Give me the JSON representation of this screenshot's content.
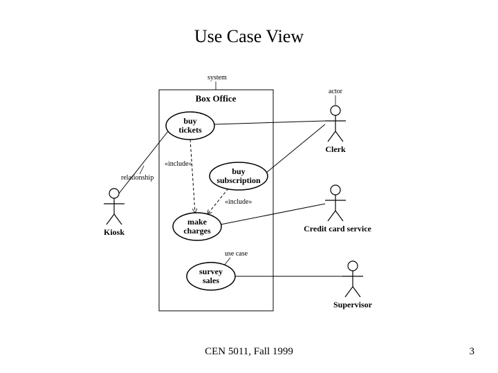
{
  "title": "Use Case View",
  "footer": "CEN 5011, Fall 1999",
  "page_number": "3",
  "diagram": {
    "annotations": {
      "system": "system",
      "actor": "actor",
      "relationship": "relationship",
      "use_case": "use case"
    },
    "system_name": "Box Office",
    "include_label_1": "«include»",
    "include_label_2": "«include»",
    "use_cases": {
      "buy_tickets": {
        "line1": "buy",
        "line2": "tickets"
      },
      "buy_subscription": {
        "line1": "buy",
        "line2": "subscription"
      },
      "make_charges": {
        "line1": "make",
        "line2": "charges"
      },
      "survey_sales": {
        "line1": "survey",
        "line2": "sales"
      }
    },
    "actors": {
      "kiosk": "Kiosk",
      "clerk": "Clerk",
      "credit_card_service": "Credit card service",
      "supervisor": "Supervisor"
    }
  }
}
